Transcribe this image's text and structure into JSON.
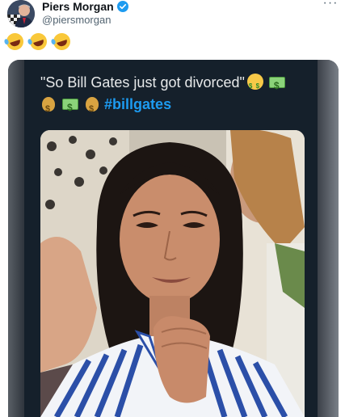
{
  "tweet": {
    "author": {
      "display_name": "Piers Morgan",
      "handle": "@piersmorgan",
      "verified_icon": "verified-badge-icon",
      "avatar_icon": "avatar"
    },
    "more_icon": "more-options-icon",
    "more_label": "···",
    "text_emojis": [
      "rolling-on-floor-laughing",
      "rolling-on-floor-laughing",
      "rolling-on-floor-laughing"
    ]
  },
  "embedded_post": {
    "text_quote": "\"So Bill Gates just got divorced\"",
    "hashtag": "#billgates",
    "emoji_sequence": [
      "money-mouth-face",
      "dollar-banknote",
      "money-bag",
      "dollar-banknote",
      "money-bag"
    ]
  },
  "colors": {
    "accent": "#1d9bf0",
    "dark_card": "#15202b",
    "muted_text": "#536471"
  }
}
